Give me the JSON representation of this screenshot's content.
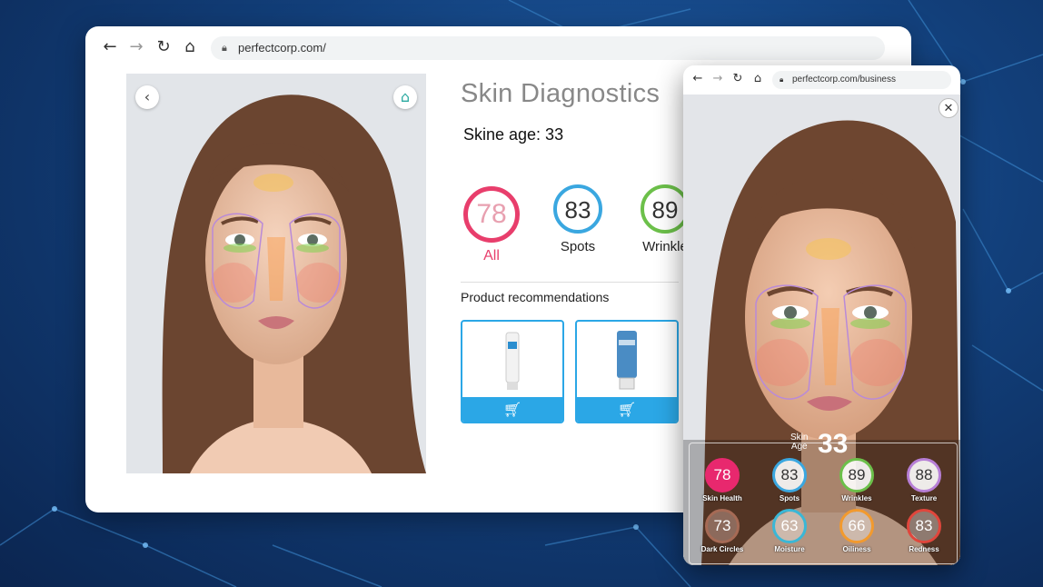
{
  "main_window": {
    "url": "perfectcorp.com/",
    "title": "Skin Diagnostics",
    "skin_age_text": "Skine age: 33",
    "scores": [
      {
        "value": "78",
        "label": "All",
        "color": "#e83e6c"
      },
      {
        "value": "83",
        "label": "Spots",
        "color": "#3aa7e0"
      },
      {
        "value": "89",
        "label": "Wrinkle",
        "color": "#6cc04a"
      }
    ],
    "product_recommendations_label": "Product recommendations",
    "products": [
      {
        "name": "cream-tube"
      },
      {
        "name": "cleanser-bottle"
      }
    ]
  },
  "popup_window": {
    "url": "perfectcorp.com/business",
    "skin_age_label": "Skin\nAge",
    "skin_age_value": "33",
    "metrics": [
      {
        "value": "78",
        "label": "Skin Health",
        "color": "#e8286e",
        "filled": true
      },
      {
        "value": "83",
        "label": "Spots",
        "color": "#3aa7e0"
      },
      {
        "value": "89",
        "label": "Wrinkles",
        "color": "#6cc04a"
      },
      {
        "value": "88",
        "label": "Texture",
        "color": "#b77fd6"
      },
      {
        "value": "73",
        "label": "Dark Circles",
        "color": "#a66a55"
      },
      {
        "value": "63",
        "label": "Moisture",
        "color": "#3ab7d6"
      },
      {
        "value": "66",
        "label": "Oiliness",
        "color": "#f29a2e"
      },
      {
        "value": "83",
        "label": "Redness",
        "color": "#e0463c"
      }
    ]
  },
  "colors": {
    "accent_blue": "#2ba7e6",
    "home_teal": "#2aa9a0",
    "background": "#123f7a"
  }
}
